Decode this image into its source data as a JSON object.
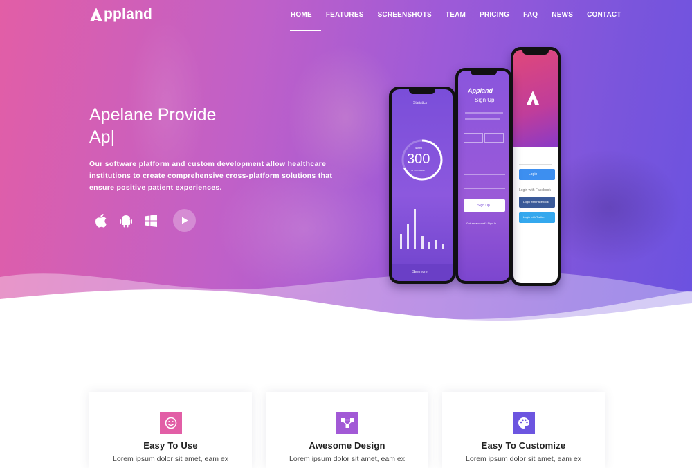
{
  "brand": {
    "name": "ppland"
  },
  "nav": {
    "items": [
      "HOME",
      "FEATURES",
      "SCREENSHOTS",
      "TEAM",
      "PRICING",
      "FAQ",
      "NEWS",
      "CONTACT"
    ],
    "active": "HOME"
  },
  "hero": {
    "title_line1": "Apelane Provide",
    "title_line2": "Ap|",
    "description": "Our software platform and custom development allow healthcare institutions to create comprehensive cross-platform solutions that ensure positive patient experiences.",
    "store_icons": [
      "apple-icon",
      "android-icon",
      "windows-icon",
      "play-icon"
    ]
  },
  "phone_left": {
    "header": "Statistics",
    "sub": "450m",
    "value": "300",
    "unit": "IN THIS WEEK",
    "footer": "See more",
    "bar_levels": [
      0.35,
      0.6,
      0.95,
      0.3,
      0.15,
      0.2,
      0.12
    ]
  },
  "phone_middle": {
    "logo": "Appland",
    "title": "Sign Up",
    "button": "Sign Up",
    "footer": "Got an account? Sign In"
  },
  "phone_right": {
    "button1": "Login",
    "button2": "Login with Facebook",
    "button3": "Login with Twitter"
  },
  "features": [
    {
      "title": "Easy To Use",
      "text": "Lorem ipsum dolor sit amet, eam ex",
      "icon": "smile-icon",
      "color": "#e25ea6"
    },
    {
      "title": "Awesome Design",
      "text": "Lorem ipsum dolor sit amet, eam ex",
      "icon": "design-nodes-icon",
      "color": "#a259d6"
    },
    {
      "title": "Easy To Customize",
      "text": "Lorem ipsum dolor sit amet, eam ex",
      "icon": "palette-icon",
      "color": "#6c55e0"
    }
  ]
}
